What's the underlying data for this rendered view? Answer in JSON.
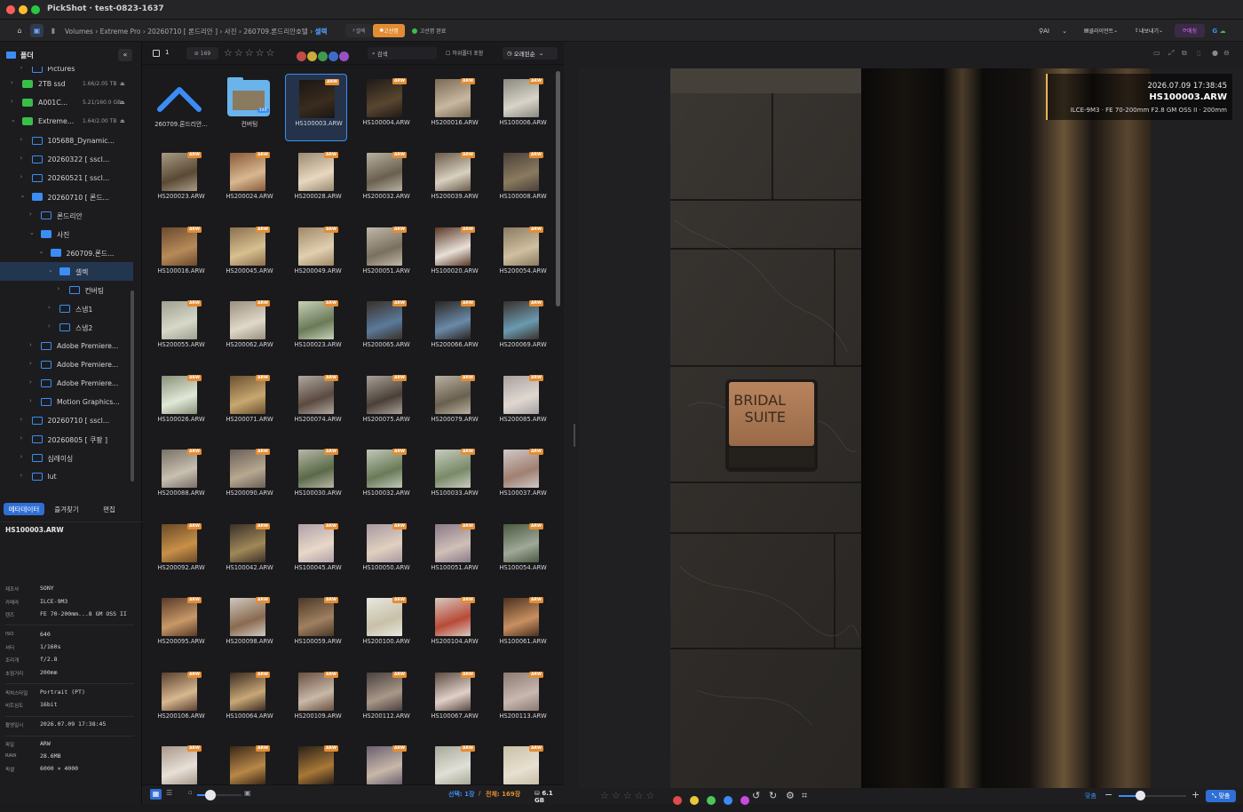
{
  "window": {
    "title": "PickShot · test-0823-1637"
  },
  "toolbar": {
    "breadcrumb": [
      "Volumes",
      "Extreme Pro",
      "20260710 [ 론드리안 ]",
      "사진",
      "260709.론드리안호텔"
    ],
    "breadcrumb_current": "셀렉",
    "mode1": "셀렉",
    "mode2": "고선명",
    "status": "고선명 완료",
    "ai": "AI",
    "client": "클라이언트",
    "export": "내보내기",
    "sync": "매칭",
    "g": "G"
  },
  "sidebar": {
    "header": "폴더",
    "items": [
      {
        "label": "Pictures",
        "depth": 1,
        "kind": "folder"
      },
      {
        "label": "2TB ssd",
        "meta": "1.66/2.05 TB",
        "depth": 0,
        "kind": "drive"
      },
      {
        "label": "A001C...",
        "meta": "5.21/160.0 GB",
        "depth": 0,
        "kind": "drive"
      },
      {
        "label": "Extreme...",
        "meta": "1.64/2.00 TB",
        "depth": 0,
        "kind": "drive"
      },
      {
        "label": "105688_Dynamic...",
        "depth": 1,
        "kind": "folder"
      },
      {
        "label": "20260322 [ sscl...",
        "depth": 1,
        "kind": "folder"
      },
      {
        "label": "20260521 [ sscl...",
        "depth": 1,
        "kind": "folder"
      },
      {
        "label": "20260710 [ 론드...",
        "depth": 1,
        "kind": "folder"
      },
      {
        "label": "론드리안",
        "depth": 2,
        "kind": "folder"
      },
      {
        "label": "사진",
        "depth": 2,
        "kind": "folder"
      },
      {
        "label": "260709.론드...",
        "depth": 3,
        "kind": "folder"
      },
      {
        "label": "셀렉",
        "depth": 4,
        "kind": "folder",
        "selected": true
      },
      {
        "label": "컨버팅",
        "depth": 5,
        "kind": "folder"
      },
      {
        "label": "스냅1",
        "depth": 4,
        "kind": "folder"
      },
      {
        "label": "스냅2",
        "depth": 4,
        "kind": "folder"
      },
      {
        "label": "Adobe Premiere...",
        "depth": 2,
        "kind": "folder"
      },
      {
        "label": "Adobe Premiere...",
        "depth": 2,
        "kind": "folder"
      },
      {
        "label": "Adobe Premiere...",
        "depth": 2,
        "kind": "folder"
      },
      {
        "label": "Motion Graphics...",
        "depth": 2,
        "kind": "folder"
      },
      {
        "label": "20260710 [ sscl...",
        "depth": 1,
        "kind": "folder"
      },
      {
        "label": "20260805 [ 쿠팡 ]",
        "depth": 1,
        "kind": "folder"
      },
      {
        "label": "심레이싱",
        "depth": 1,
        "kind": "folder"
      },
      {
        "label": "lut",
        "depth": 1,
        "kind": "folder"
      }
    ],
    "tabs": [
      "메타데이터",
      "즐겨찾기",
      "편집"
    ]
  },
  "metadata": {
    "filename": "HS100003.ARW",
    "rows": [
      {
        "k": "제조사",
        "v": "SONY"
      },
      {
        "k": "카메라",
        "v": "ILCE-9M3"
      },
      {
        "k": "렌즈",
        "v": "FE 70-200mm...8 GM OSS II"
      },
      {
        "k": "ISO",
        "v": "640"
      },
      {
        "k": "셔터",
        "v": "1/160s"
      },
      {
        "k": "조리개",
        "v": "f/2.8"
      },
      {
        "k": "초점거리",
        "v": "200mm"
      },
      {
        "k": "픽쳐스타일",
        "v": "Portrait (PT)"
      },
      {
        "k": "비트심도",
        "v": "16bit"
      },
      {
        "k": "촬영일시",
        "v": "2026.07.09 17:38:45"
      },
      {
        "k": "파일",
        "v": "ARW"
      },
      {
        "k": "RAW",
        "v": "28.6MB"
      },
      {
        "k": "픽셀",
        "v": "6000 × 4000"
      }
    ]
  },
  "filter": {
    "count": "1",
    "flagged": "169",
    "search": "검색",
    "subfolder": "하위폴더 포함",
    "sort": "오래된순"
  },
  "grid": {
    "badge": "ARW",
    "folder_count": "144",
    "items": [
      "260709.론드리안...",
      "컨버팅",
      "HS100003.ARW",
      "HS100004.ARW",
      "HS200016.ARW",
      "HS100006.ARW",
      "HS200023.ARW",
      "HS200024.ARW",
      "HS200028.ARW",
      "HS200032.ARW",
      "HS200039.ARW",
      "HS100008.ARW",
      "HS100016.ARW",
      "HS200045.ARW",
      "HS200049.ARW",
      "HS200051.ARW",
      "HS100020.ARW",
      "HS200054.ARW",
      "HS200055.ARW",
      "HS200062.ARW",
      "HS100023.ARW",
      "HS200065.ARW",
      "HS200066.ARW",
      "HS200069.ARW",
      "HS100026.ARW",
      "HS200071.ARW",
      "HS200074.ARW",
      "HS200075.ARW",
      "HS200079.ARW",
      "HS200085.ARW",
      "HS200088.ARW",
      "HS200090.ARW",
      "HS100030.ARW",
      "HS100032.ARW",
      "HS100033.ARW",
      "HS100037.ARW",
      "HS200092.ARW",
      "HS100042.ARW",
      "HS100045.ARW",
      "HS100050.ARW",
      "HS100051.ARW",
      "HS100054.ARW",
      "HS200095.ARW",
      "HS200098.ARW",
      "HS100059.ARW",
      "HS200100.ARW",
      "HS200104.ARW",
      "HS100061.ARW",
      "HS200106.ARW",
      "HS100064.ARW",
      "HS200109.ARW",
      "HS200112.ARW",
      "HS100067.ARW",
      "HS200113.ARW",
      "",
      "",
      "",
      "",
      "",
      ""
    ]
  },
  "gridstatus": {
    "selected": "선택: 1장",
    "total": "전체: 169장",
    "size": "6.1 GB"
  },
  "viewer": {
    "date": "2026.07.09 17:38:45",
    "file": "HS100003.ARW",
    "exif": "ILCE-9M3 · FE 70-200mm F2.8 GM OSS II · 200mm",
    "sign_line1": "BRIDAL",
    "sign_line2": "SUITE",
    "fit": "맞춤",
    "action": "맞춤"
  },
  "colors": {
    "accent": "#3b8df5",
    "badge": "#e38d33",
    "orange": "#e38d33"
  }
}
